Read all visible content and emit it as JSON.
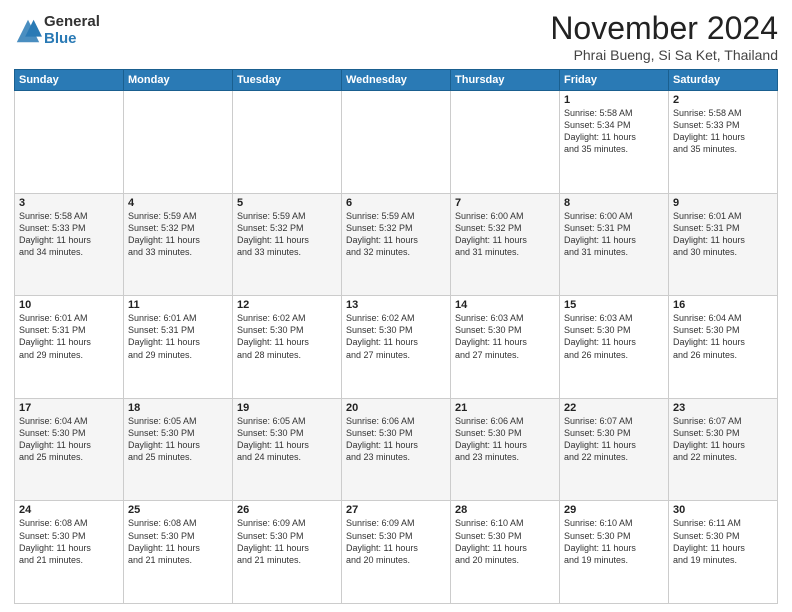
{
  "header": {
    "logo_general": "General",
    "logo_blue": "Blue",
    "month": "November 2024",
    "location": "Phrai Bueng, Si Sa Ket, Thailand"
  },
  "weekdays": [
    "Sunday",
    "Monday",
    "Tuesday",
    "Wednesday",
    "Thursday",
    "Friday",
    "Saturday"
  ],
  "weeks": [
    [
      {
        "day": "",
        "info": ""
      },
      {
        "day": "",
        "info": ""
      },
      {
        "day": "",
        "info": ""
      },
      {
        "day": "",
        "info": ""
      },
      {
        "day": "",
        "info": ""
      },
      {
        "day": "1",
        "info": "Sunrise: 5:58 AM\nSunset: 5:34 PM\nDaylight: 11 hours\nand 35 minutes."
      },
      {
        "day": "2",
        "info": "Sunrise: 5:58 AM\nSunset: 5:33 PM\nDaylight: 11 hours\nand 35 minutes."
      }
    ],
    [
      {
        "day": "3",
        "info": "Sunrise: 5:58 AM\nSunset: 5:33 PM\nDaylight: 11 hours\nand 34 minutes."
      },
      {
        "day": "4",
        "info": "Sunrise: 5:59 AM\nSunset: 5:32 PM\nDaylight: 11 hours\nand 33 minutes."
      },
      {
        "day": "5",
        "info": "Sunrise: 5:59 AM\nSunset: 5:32 PM\nDaylight: 11 hours\nand 33 minutes."
      },
      {
        "day": "6",
        "info": "Sunrise: 5:59 AM\nSunset: 5:32 PM\nDaylight: 11 hours\nand 32 minutes."
      },
      {
        "day": "7",
        "info": "Sunrise: 6:00 AM\nSunset: 5:32 PM\nDaylight: 11 hours\nand 31 minutes."
      },
      {
        "day": "8",
        "info": "Sunrise: 6:00 AM\nSunset: 5:31 PM\nDaylight: 11 hours\nand 31 minutes."
      },
      {
        "day": "9",
        "info": "Sunrise: 6:01 AM\nSunset: 5:31 PM\nDaylight: 11 hours\nand 30 minutes."
      }
    ],
    [
      {
        "day": "10",
        "info": "Sunrise: 6:01 AM\nSunset: 5:31 PM\nDaylight: 11 hours\nand 29 minutes."
      },
      {
        "day": "11",
        "info": "Sunrise: 6:01 AM\nSunset: 5:31 PM\nDaylight: 11 hours\nand 29 minutes."
      },
      {
        "day": "12",
        "info": "Sunrise: 6:02 AM\nSunset: 5:30 PM\nDaylight: 11 hours\nand 28 minutes."
      },
      {
        "day": "13",
        "info": "Sunrise: 6:02 AM\nSunset: 5:30 PM\nDaylight: 11 hours\nand 27 minutes."
      },
      {
        "day": "14",
        "info": "Sunrise: 6:03 AM\nSunset: 5:30 PM\nDaylight: 11 hours\nand 27 minutes."
      },
      {
        "day": "15",
        "info": "Sunrise: 6:03 AM\nSunset: 5:30 PM\nDaylight: 11 hours\nand 26 minutes."
      },
      {
        "day": "16",
        "info": "Sunrise: 6:04 AM\nSunset: 5:30 PM\nDaylight: 11 hours\nand 26 minutes."
      }
    ],
    [
      {
        "day": "17",
        "info": "Sunrise: 6:04 AM\nSunset: 5:30 PM\nDaylight: 11 hours\nand 25 minutes."
      },
      {
        "day": "18",
        "info": "Sunrise: 6:05 AM\nSunset: 5:30 PM\nDaylight: 11 hours\nand 25 minutes."
      },
      {
        "day": "19",
        "info": "Sunrise: 6:05 AM\nSunset: 5:30 PM\nDaylight: 11 hours\nand 24 minutes."
      },
      {
        "day": "20",
        "info": "Sunrise: 6:06 AM\nSunset: 5:30 PM\nDaylight: 11 hours\nand 23 minutes."
      },
      {
        "day": "21",
        "info": "Sunrise: 6:06 AM\nSunset: 5:30 PM\nDaylight: 11 hours\nand 23 minutes."
      },
      {
        "day": "22",
        "info": "Sunrise: 6:07 AM\nSunset: 5:30 PM\nDaylight: 11 hours\nand 22 minutes."
      },
      {
        "day": "23",
        "info": "Sunrise: 6:07 AM\nSunset: 5:30 PM\nDaylight: 11 hours\nand 22 minutes."
      }
    ],
    [
      {
        "day": "24",
        "info": "Sunrise: 6:08 AM\nSunset: 5:30 PM\nDaylight: 11 hours\nand 21 minutes."
      },
      {
        "day": "25",
        "info": "Sunrise: 6:08 AM\nSunset: 5:30 PM\nDaylight: 11 hours\nand 21 minutes."
      },
      {
        "day": "26",
        "info": "Sunrise: 6:09 AM\nSunset: 5:30 PM\nDaylight: 11 hours\nand 21 minutes."
      },
      {
        "day": "27",
        "info": "Sunrise: 6:09 AM\nSunset: 5:30 PM\nDaylight: 11 hours\nand 20 minutes."
      },
      {
        "day": "28",
        "info": "Sunrise: 6:10 AM\nSunset: 5:30 PM\nDaylight: 11 hours\nand 20 minutes."
      },
      {
        "day": "29",
        "info": "Sunrise: 6:10 AM\nSunset: 5:30 PM\nDaylight: 11 hours\nand 19 minutes."
      },
      {
        "day": "30",
        "info": "Sunrise: 6:11 AM\nSunset: 5:30 PM\nDaylight: 11 hours\nand 19 minutes."
      }
    ]
  ]
}
